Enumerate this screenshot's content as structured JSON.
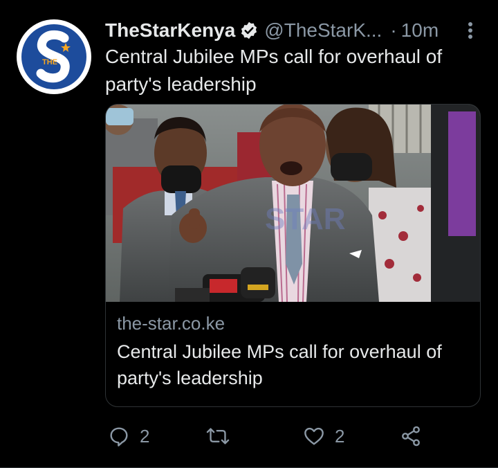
{
  "tweet": {
    "display_name": "TheStarKenya",
    "handle": "@TheStarK...",
    "separator": "·",
    "time": "10m",
    "text": "Central Jubilee MPs call for overhaul of party's leadership",
    "avatar_icon": "the-star-logo",
    "verified_icon": "verified-badge-icon",
    "colors": {
      "background": "#000000",
      "primary_text": "#e7e9ea",
      "secondary_text": "#8b98a5",
      "avatar_blue": "#1d4c9c"
    }
  },
  "card": {
    "image_alt": "MPs addressing the press",
    "domain": "the-star.co.ke",
    "title": "Central Jubilee MPs call for overhaul of party's leadership"
  },
  "actions": {
    "reply": {
      "icon": "reply-icon",
      "count": "2"
    },
    "retweet": {
      "icon": "retweet-icon",
      "count": ""
    },
    "like": {
      "icon": "heart-icon",
      "count": "2"
    },
    "share": {
      "icon": "share-icon"
    }
  }
}
